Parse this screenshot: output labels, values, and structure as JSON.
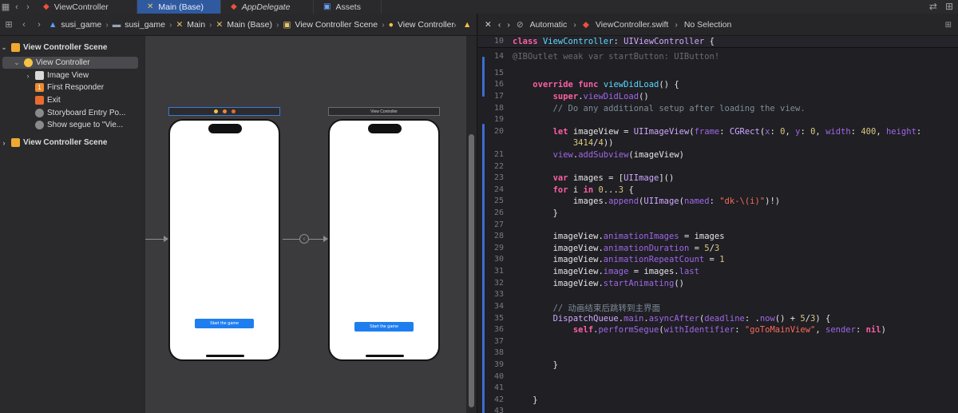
{
  "tabs": [
    {
      "label": "ViewController",
      "icon": "swift-file-icon",
      "active": false
    },
    {
      "label": "Main (Base)",
      "icon": "storyboard-icon",
      "active": true
    },
    {
      "label": "AppDelegate",
      "icon": "swift-file-icon",
      "active": false
    },
    {
      "label": "Assets",
      "icon": "asset-catalog-icon",
      "active": false
    }
  ],
  "breadcrumb": [
    "susi_game",
    "susi_game",
    "Main",
    "Main (Base)",
    "View Controller Scene",
    "View Controller"
  ],
  "outline": [
    {
      "label": "View Controller Scene",
      "icon": "scene-icon",
      "disclosure": "open"
    },
    {
      "label": "View Controller",
      "icon": "view-controller-icon",
      "disclosure": "open",
      "selected": true
    },
    {
      "label": "Image View",
      "icon": "image-view-icon",
      "disclosure": "closed"
    },
    {
      "label": "First Responder",
      "icon": "first-responder-icon",
      "disclosure": ""
    },
    {
      "label": "Exit",
      "icon": "exit-icon",
      "disclosure": ""
    },
    {
      "label": "Storyboard Entry Po...",
      "icon": "entry-point-icon",
      "disclosure": ""
    },
    {
      "label": "Show segue to \"Vie...",
      "icon": "segue-icon",
      "disclosure": ""
    },
    {
      "label": "View Controller Scene",
      "icon": "scene-icon",
      "disclosure": "closed"
    }
  ],
  "canvas": {
    "second_scene_title": "View Controller",
    "button_label": "Start the game"
  },
  "code_header": {
    "mode": "Automatic",
    "file": "ViewController.swift",
    "selection": "No Selection"
  },
  "code_lines": [
    {
      "n": "10",
      "text": "class ViewController: UIViewController {"
    },
    {
      "n": "14",
      "text": "@IBOutlet weak var startButton: UIButton!"
    },
    {
      "n": "15",
      "text": ""
    },
    {
      "n": "16",
      "text": "    override func viewDidLoad() {"
    },
    {
      "n": "17",
      "text": "        super.viewDidLoad()"
    },
    {
      "n": "18",
      "text": "        // Do any additional setup after loading the view."
    },
    {
      "n": "19",
      "text": ""
    },
    {
      "n": "20",
      "text": "        let imageView = UIImageView(frame: CGRect(x: 0, y: 0, width: 400, height:"
    },
    {
      "n": "",
      "text": "            3414/4))"
    },
    {
      "n": "21",
      "text": "        view.addSubview(imageView)"
    },
    {
      "n": "22",
      "text": ""
    },
    {
      "n": "23",
      "text": "        var images = [UIImage]()"
    },
    {
      "n": "24",
      "text": "        for i in 0...3 {"
    },
    {
      "n": "25",
      "text": "            images.append(UIImage(named: \"dk-\\(i)\")!)"
    },
    {
      "n": "26",
      "text": "        }"
    },
    {
      "n": "27",
      "text": ""
    },
    {
      "n": "28",
      "text": "        imageView.animationImages = images"
    },
    {
      "n": "29",
      "text": "        imageView.animationDuration = 5/3"
    },
    {
      "n": "30",
      "text": "        imageView.animationRepeatCount = 1"
    },
    {
      "n": "31",
      "text": "        imageView.image = images.last"
    },
    {
      "n": "32",
      "text": "        imageView.startAnimating()"
    },
    {
      "n": "33",
      "text": ""
    },
    {
      "n": "34",
      "text": "        // 动画结束后跳转到主界面"
    },
    {
      "n": "35",
      "text": "        DispatchQueue.main.asyncAfter(deadline: .now() + 5/3) {"
    },
    {
      "n": "36",
      "text": "            self.performSegue(withIdentifier: \"goToMainView\", sender: nil)"
    },
    {
      "n": "37",
      "text": ""
    },
    {
      "n": "38",
      "text": ""
    },
    {
      "n": "39",
      "text": "        }"
    },
    {
      "n": "40",
      "text": ""
    },
    {
      "n": "41",
      "text": ""
    },
    {
      "n": "42",
      "text": "    }"
    },
    {
      "n": "43",
      "text": ""
    }
  ],
  "colors": {
    "active_tab": "#2f5aa0",
    "keyword": "#fc5fa3",
    "type": "#5dd8ff",
    "string": "#fc6a5d",
    "number": "#d9c97c",
    "comment": "#7f8c98",
    "button": "#1e7ef0"
  }
}
